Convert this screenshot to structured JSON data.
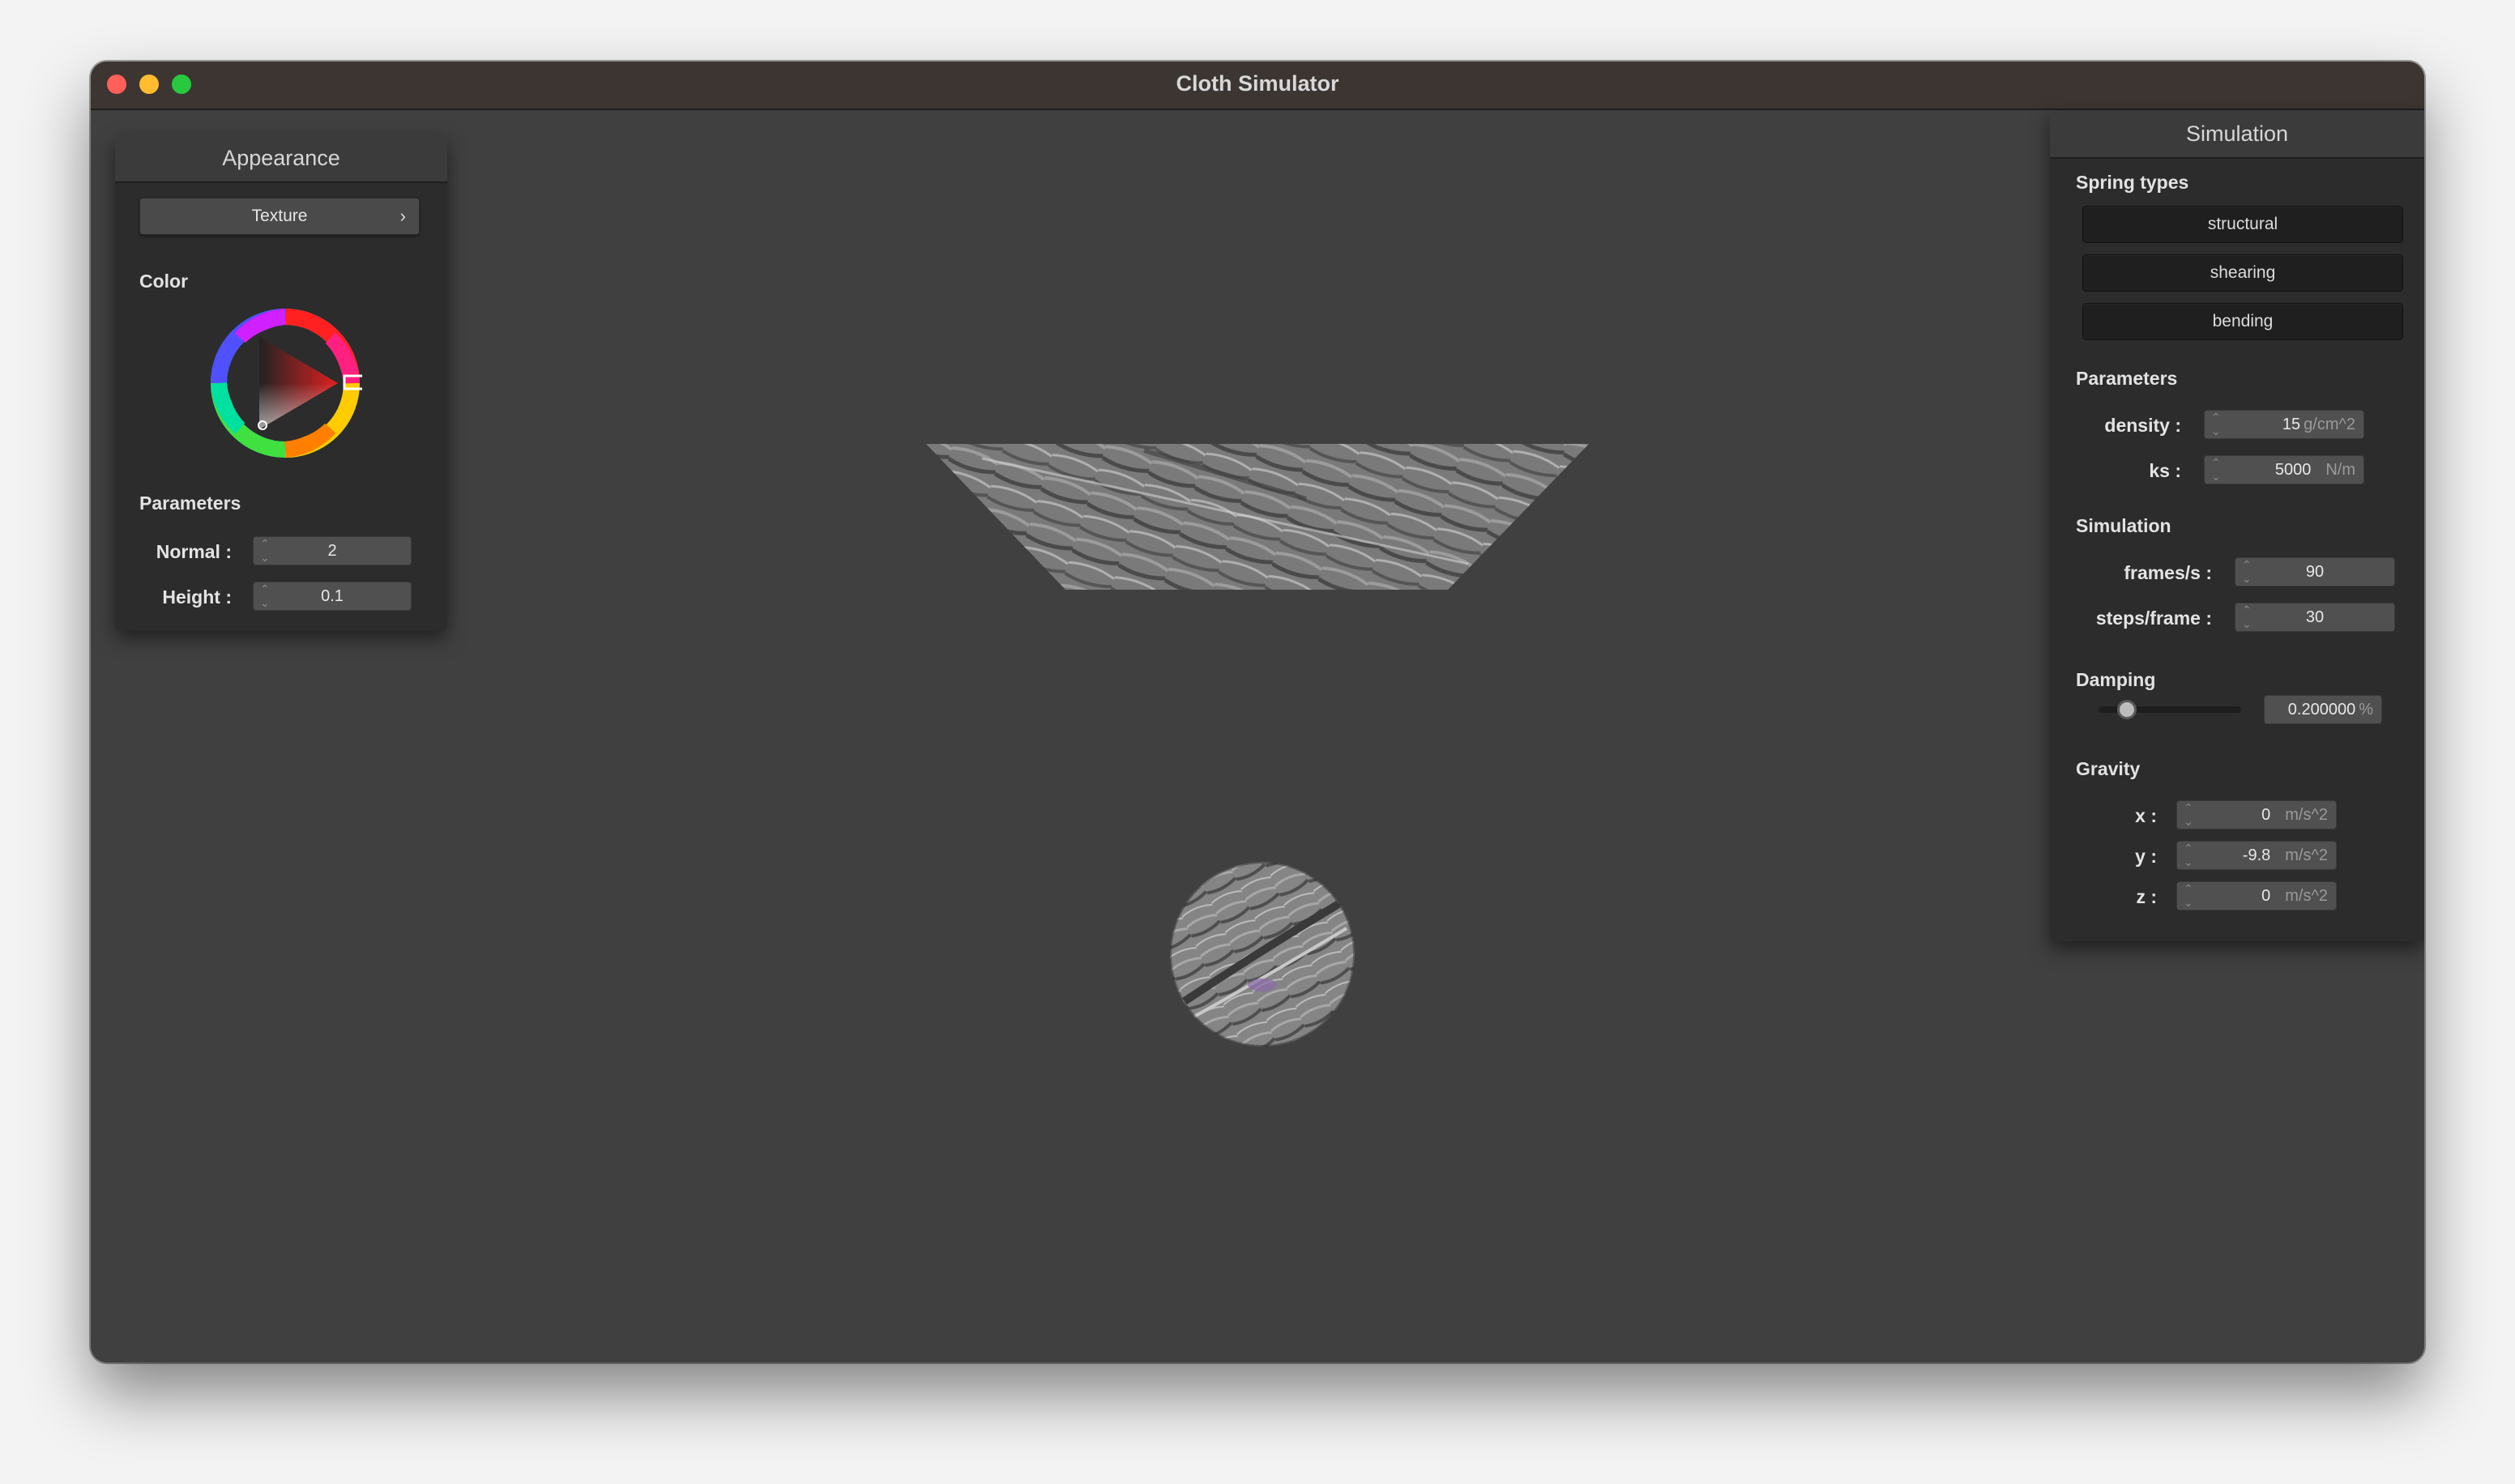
{
  "window": {
    "title": "Cloth Simulator"
  },
  "appearance": {
    "header": "Appearance",
    "texture_dropdown": "Texture",
    "color_label": "Color",
    "params_label": "Parameters",
    "normal_label": "Normal :",
    "normal_value": "2",
    "height_label": "Height :",
    "height_value": "0.1"
  },
  "simulation_panel": {
    "header": "Simulation",
    "spring_types_label": "Spring types",
    "spring_buttons": [
      "structural",
      "shearing",
      "bending"
    ],
    "parameters_label": "Parameters",
    "density_label": "density :",
    "density_value": "15",
    "density_unit": "g/cm^2",
    "ks_label": "ks :",
    "ks_value": "5000",
    "ks_unit": "N/m",
    "simulation_label": "Simulation",
    "fps_label": "frames/s :",
    "fps_value": "90",
    "steps_label": "steps/frame :",
    "steps_value": "30",
    "damping_label": "Damping",
    "damping_value": "0.200000",
    "damping_unit": "%",
    "damping_fraction": 0.2,
    "gravity_label": "Gravity",
    "gx_label": "x :",
    "gx_value": "0",
    "gy_label": "y :",
    "gy_value": "-9.8",
    "gz_label": "z :",
    "gz_value": "0",
    "g_unit": "m/s^2"
  },
  "colors": {
    "background": "#404040",
    "panel": "#2c2c2c",
    "picker_selected": "#e02020"
  }
}
